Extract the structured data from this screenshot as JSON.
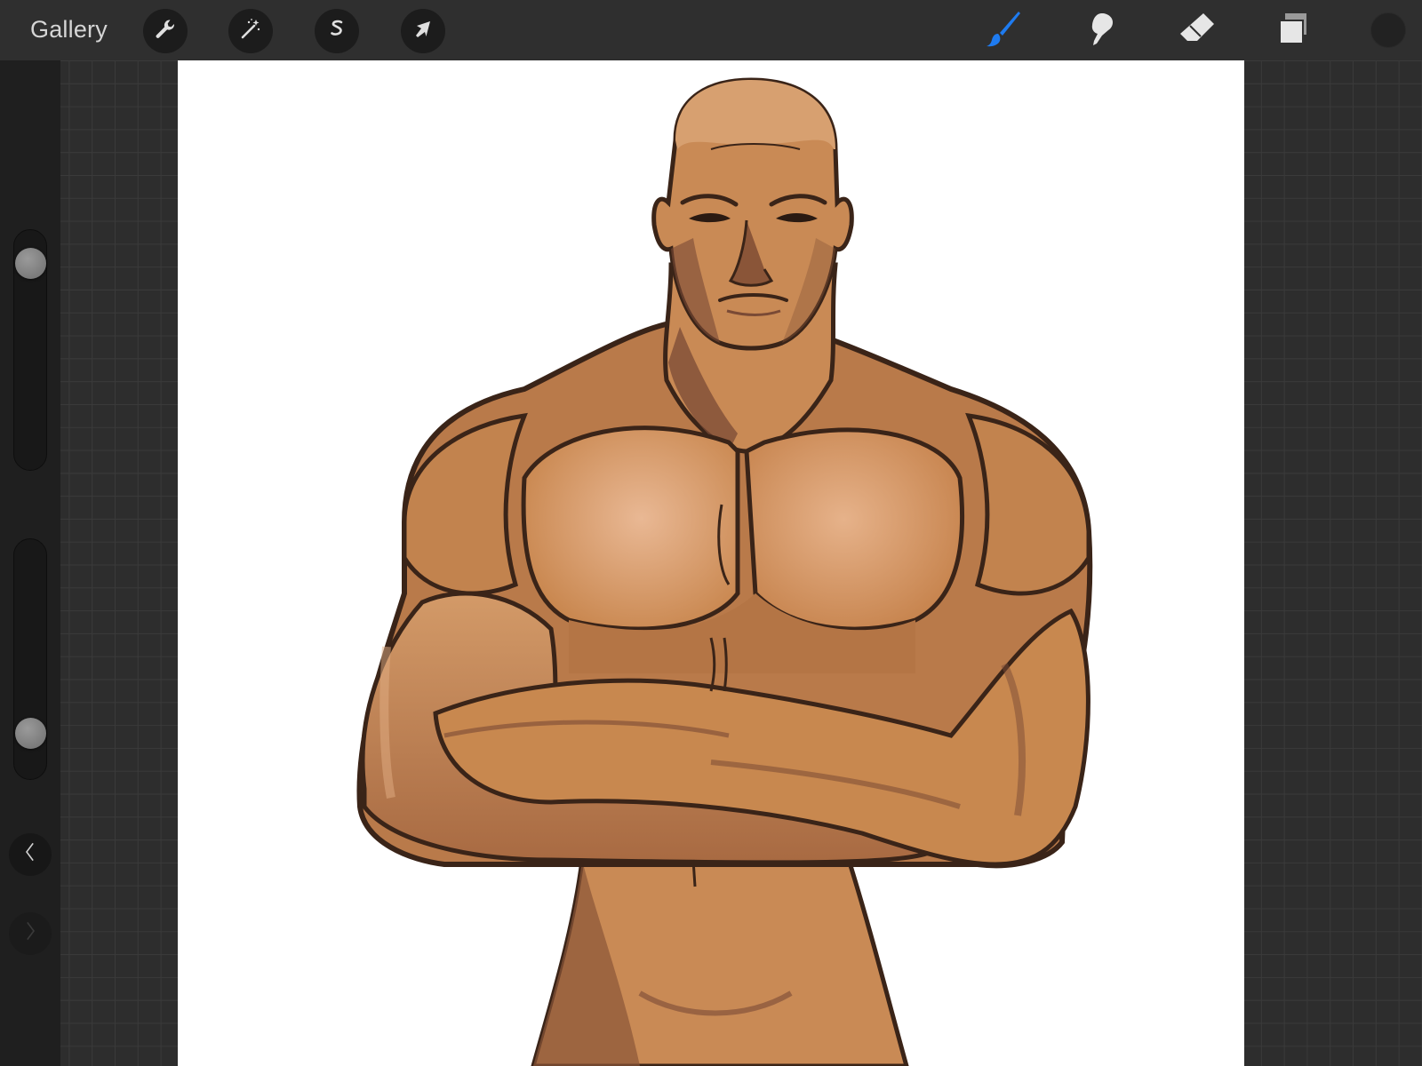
{
  "topbar": {
    "gallery_label": "Gallery",
    "left_tools": [
      {
        "name": "actions",
        "icon": "wrench-icon"
      },
      {
        "name": "adjustments",
        "icon": "magic-wand-icon"
      },
      {
        "name": "selection",
        "icon": "selection-s-icon"
      },
      {
        "name": "transform",
        "icon": "arrow-cursor-icon"
      }
    ],
    "right_tools": [
      {
        "name": "brush",
        "icon": "brush-icon",
        "active": true
      },
      {
        "name": "smudge",
        "icon": "smudge-finger-icon",
        "active": false
      },
      {
        "name": "eraser",
        "icon": "eraser-icon",
        "active": false
      },
      {
        "name": "layers",
        "icon": "layers-icon",
        "active": false
      }
    ],
    "active_color": "#1a1a1a",
    "accent_color": "#1e7bf0"
  },
  "sidebar": {
    "brush_size": 0.92,
    "brush_opacity": 0.14,
    "undo_icon": "chevron-left-icon",
    "redo_icon": "chevron-right-icon",
    "redo_enabled": false
  },
  "canvas": {
    "background": "#ffffff",
    "artwork": "muscular-figure-arms-crossed",
    "skin_color": "#c98a55",
    "shadow_color": "#7a4a35",
    "line_color": "#3a2418"
  }
}
